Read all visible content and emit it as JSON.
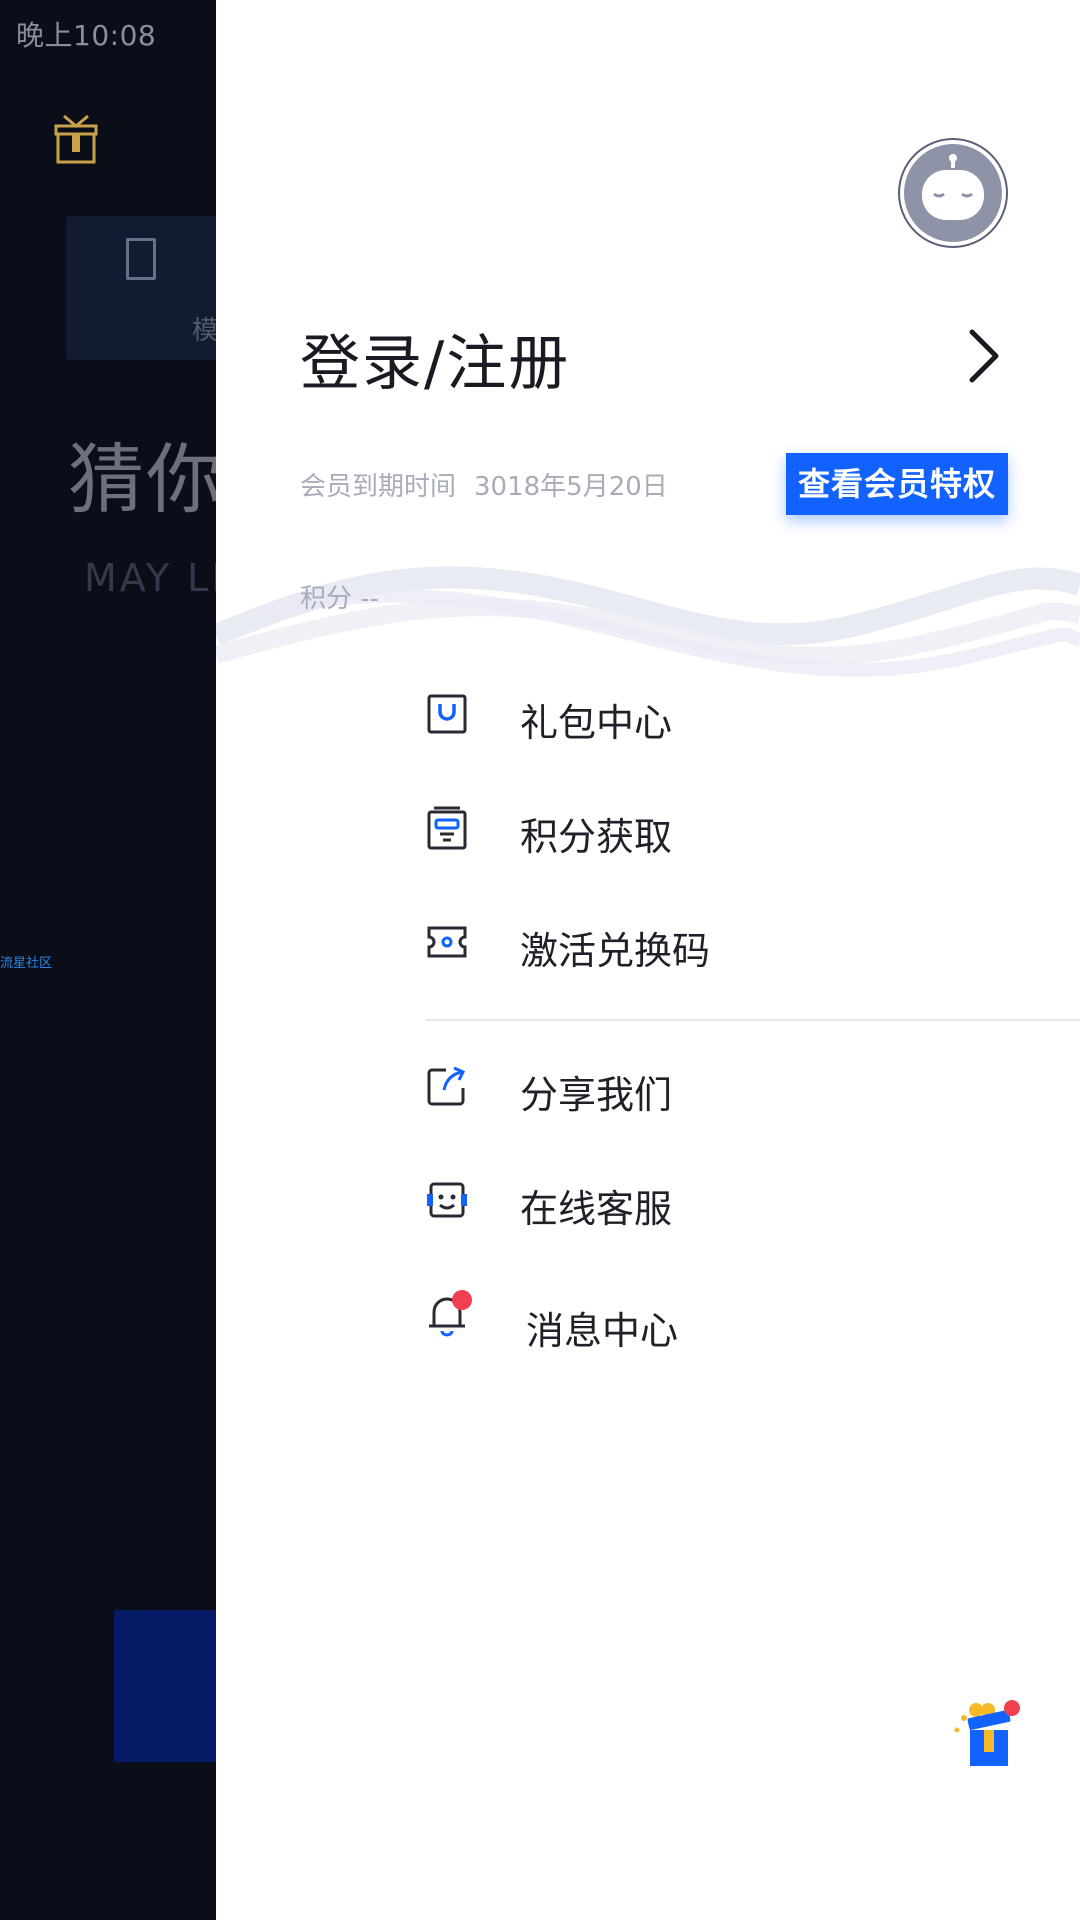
{
  "status_bar": {
    "time": "晚上10:08"
  },
  "background_app": {
    "card_label": "模",
    "headline": "猜你",
    "subheadline": "MAY LIK",
    "community_link": "流星社区"
  },
  "drawer": {
    "login_label": "登录/注册",
    "membership": {
      "label": "会员到期时间",
      "expiry_date": "3018年5月20日"
    },
    "vip_button": "查看会员特权",
    "points": {
      "label": "积分",
      "value": "--"
    },
    "menu_group_1": [
      {
        "label": "礼包中心",
        "icon": "gift-bag-icon"
      },
      {
        "label": "积分获取",
        "icon": "points-book-icon"
      },
      {
        "label": "激活兑换码",
        "icon": "ticket-icon"
      }
    ],
    "menu_group_2": [
      {
        "label": "分享我们",
        "icon": "share-icon"
      },
      {
        "label": "在线客服",
        "icon": "customer-service-icon"
      },
      {
        "label": "消息中心",
        "icon": "bell-icon",
        "badge": true
      }
    ]
  },
  "colors": {
    "accent": "#1262ff",
    "badge": "#f0404f",
    "text": "#202028",
    "muted": "#a8acb8"
  }
}
